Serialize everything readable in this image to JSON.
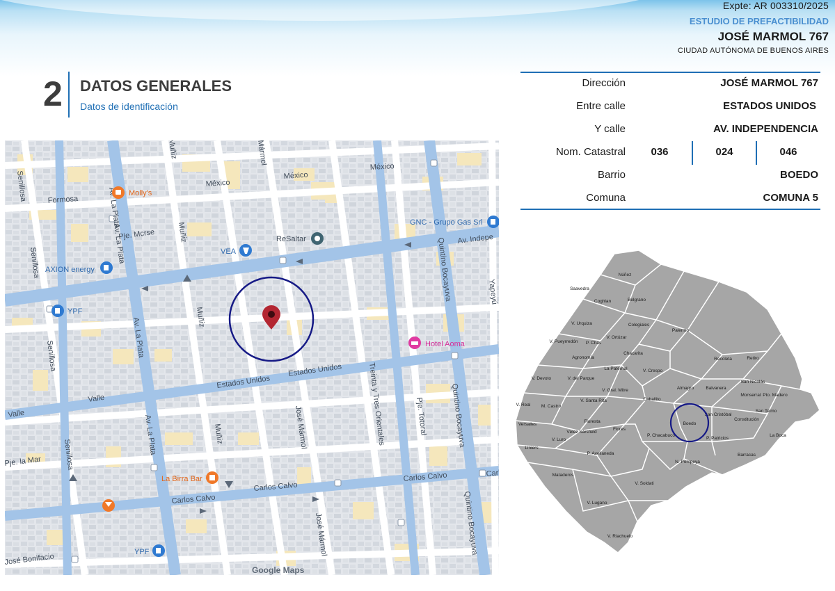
{
  "header": {
    "expte": "Expte: AR 003310/2025",
    "estudio": "ESTUDIO DE PREFACTIBILIDAD",
    "address": "JOSÉ MARMOL 767",
    "city": "CIUDAD AUTÓNOMA DE BUENOS AIRES"
  },
  "section": {
    "number": "2",
    "title": "DATOS GENERALES",
    "subtitle": "Datos de identificación"
  },
  "info": {
    "rows": [
      {
        "label": "Dirección",
        "value": "JOSÉ MARMOL 767"
      },
      {
        "label": "Entre calle",
        "value": "ESTADOS UNIDOS"
      },
      {
        "label": "Y calle",
        "value": "AV. INDEPENDENCIA"
      },
      {
        "label": "Nom. Catastral",
        "value": ""
      },
      {
        "label": "Barrio",
        "value": "BOEDO"
      },
      {
        "label": "Comuna",
        "value": "COMUNA 5"
      }
    ],
    "catastral": [
      "036",
      "024",
      "046"
    ]
  },
  "street_map": {
    "streets": {
      "mexico_1": "México",
      "mexico_2": "México",
      "formosa": "Formosa",
      "av_la_plata_1": "Av. La Plata",
      "av_la_plata_2": "Av. La Plata",
      "av_la_plata_3": "Av. La Plata",
      "av_la_plata_4": "Av. La Plata",
      "muniz_1": "Muñiz",
      "muniz_2": "Muñiz",
      "muniz_3": "Muñiz",
      "muniz_4": "Muñiz",
      "marmol_top": "Mármol",
      "jose_marmol_1": "José Mármol",
      "jose_marmol_2": "José Mármol",
      "pje_mcrse": "Pje. Mcrse",
      "av_independencia": "Av. Indepe",
      "estados_unidos_1": "Estados Unidos",
      "estados_unidos_2": "Estados Unidos",
      "valle_1": "Valle",
      "valle_2": "Valle",
      "senillosa_1": "Senillosa",
      "senillosa_2": "Senillosa",
      "senillosa_3": "Senillosa",
      "senillosa_4": "Senillosa",
      "quintino_1": "Quintino Bocayuva",
      "quintino_2": "Quintino Bocayuva",
      "quintino_3": "Quintino Bocayuva",
      "yapeyu": "Yapeyú",
      "treinta_tres": "Treinta y Tres Orientales",
      "pje_totoral": "Pje. Totoral",
      "pje_la_mar": "Pje. la Mar",
      "carlos_calvo_1": "Carlos Calvo",
      "carlos_calvo_2": "Carlos Calvo",
      "carlos_calvo_3": "Carlos Calvo",
      "jose_bonifacio": "José Bonifacio"
    },
    "places": {
      "mollys": "Molly's",
      "vea": "VEA",
      "resaltar": "ReSaltar",
      "gnc": "GNC - Grupo Gas Srl",
      "axion": "AXION energy",
      "ypf_1": "YPF",
      "ypf_2": "YPF",
      "hotel_aoma": "Hotel Aoma",
      "la_birra_bar": "La Birra Bar"
    },
    "attribution": "Google Maps"
  },
  "barrios_map": {
    "labels": {
      "nunez": "Núñez",
      "saavedra": "Saavedra",
      "coghlan": "Coghlan",
      "belgrano": "Belgrano",
      "v_urquiza": "V. Urquiza",
      "colegiales": "Colegiales",
      "palermo": "Palermo",
      "v_pueyrredon": "V. Pueyrredón",
      "p_chas": "P. Chas",
      "v_ortuzar": "V. Ortúzar",
      "chacarita": "Chacarita",
      "agronomia": "Agronomía",
      "recoleta": "Recoleta",
      "retiro": "Retiro",
      "la_paternal": "La Paternal",
      "v_crespo": "V. Crespo",
      "v_devoto": "V. Devoto",
      "v_del_parque": "V. del Parque",
      "almagro": "Almagro",
      "balvanera": "Balvanera",
      "san_nicolas": "San Nicolás",
      "v_gral_mitre": "V. Gral. Mitre",
      "monserrat": "Monserrat",
      "pto_madero": "Pto. Madero",
      "v_real": "V. Real",
      "m_castro": "M. Castro",
      "v_santa_rita": "V. Santa Rita",
      "caballito": "Caballito",
      "san_cristobal": "San Cristóbal",
      "san_telmo": "San Telmo",
      "versalles": "Versalles",
      "floresta": "Floresta",
      "boedo": "Boedo",
      "constitucion": "Constitución",
      "velez_sarsfield": "Vélez Sársfield",
      "flores": "Flores",
      "p_chacabuco": "P. Chacabuco",
      "p_patricios": "P. Patricios",
      "la_boca": "La Boca",
      "v_luro": "V. Luro",
      "liniers": "Liniers",
      "p_avellaneda": "P. Avellaneda",
      "n_pompeya": "N. Pompeya",
      "barracas": "Barracas",
      "mataderos": "Mataderos",
      "v_soldati": "V. Soldati",
      "v_lugano": "V. Lugano",
      "v_riachuelo": "V. Riachuelo"
    }
  },
  "colors": {
    "accent_blue": "#1f6fb5",
    "highlight_circle": "#161a86",
    "pin": "#b32632",
    "barrio_fill": "#a6a6a6"
  }
}
